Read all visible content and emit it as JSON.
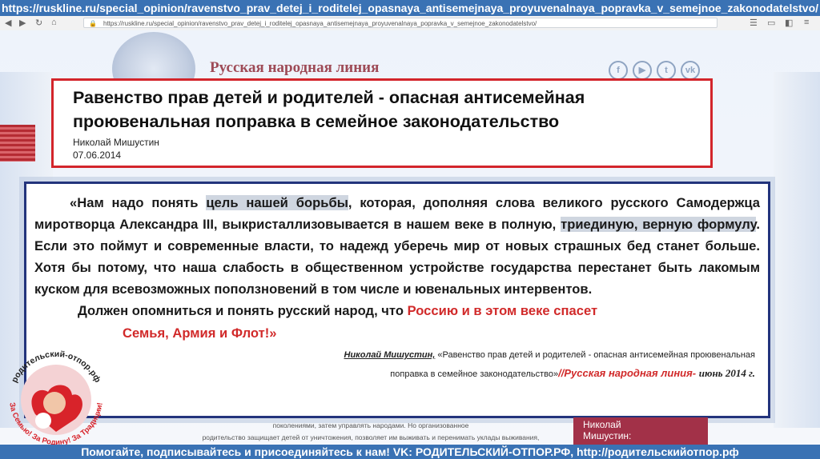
{
  "top_url": "https://ruskline.ru/special_opinion/ravenstvo_prav_detej_i_roditelej_opasnaya_antisemejnaya_proyuvenalnaya_popravka_v_semejnoe_zakonodatelstvo/",
  "browser": {
    "address": "https://ruskline.ru/special_opinion/ravenstvo_prav_detej_i_roditelej_opasnaya_antisemejnaya_proyuvenalnaya_popravka_v_semejnoe_zakonodatelstvo/"
  },
  "site": {
    "title": "Русская народная линия",
    "social_icons": [
      "facebook-icon",
      "youtube-icon",
      "twitter-icon",
      "vk-icon"
    ]
  },
  "headline": {
    "title": "Равенство прав детей и родителей - опасная антисемейная проювенальная поправка в семейное законодательство",
    "author": "Николай Мишустин",
    "date": "07.06.2014"
  },
  "quote": {
    "p1_a": "«Нам надо понять ",
    "p1_hl1": "цель нашей борьбы",
    "p1_b": ", которая, дополняя слова великого русского Самодержца миротворца Александра III, выкристаллизовывается в нашем веке в полную, ",
    "p1_hl2": "триединую, верную  формулу",
    "p1_c": ".  Если это поймут и современные власти, то надежд уберечь мир от новых страшных бед станет больше. Хотя бы потому, что наша слабость в общественном устройстве государства перестанет быть лакомым куском для всевозможных поползновений в том числе и ювенальных интервентов.",
    "p2_black": "Должен опомниться и понять русский народ, что ",
    "p2_red1": "Россию и в этом веке спасет",
    "p2_red2": "Семья, Армия и Флот!»"
  },
  "citation": {
    "author": "Николай Мишустин,",
    "text": " «Равенство прав детей и родителей - опасная антисемейная проювенальная",
    "text2": "поправка в семейное законодательство»",
    "source": "//Русская народная линия- ",
    "date": "июнь 2014 г."
  },
  "page_text": {
    "line1": "поколениями, затем управлять народами. Но организованное",
    "line2": "родительство защищает детей от уничтожения, позволяет им выживать и перенимать уклады выживания,"
  },
  "side_box": {
    "line1": "Николай",
    "line2": "Мишустин:"
  },
  "logo": {
    "top_text": "родительский-отпор.рф",
    "bottom_text": "За Семью! За Родину! За Традиции!"
  },
  "bottom_bar": "Помогайте, подписывайтесь и присоединяйтесь к нам! VK: РОДИТЕЛЬСКИЙ-ОТПОР.РФ, http://родительскийотпор.рф",
  "colors": {
    "accent_blue": "#3a72b4",
    "headline_border": "#d3252b",
    "quote_border": "#23347c",
    "red_text": "#d12a2a"
  }
}
